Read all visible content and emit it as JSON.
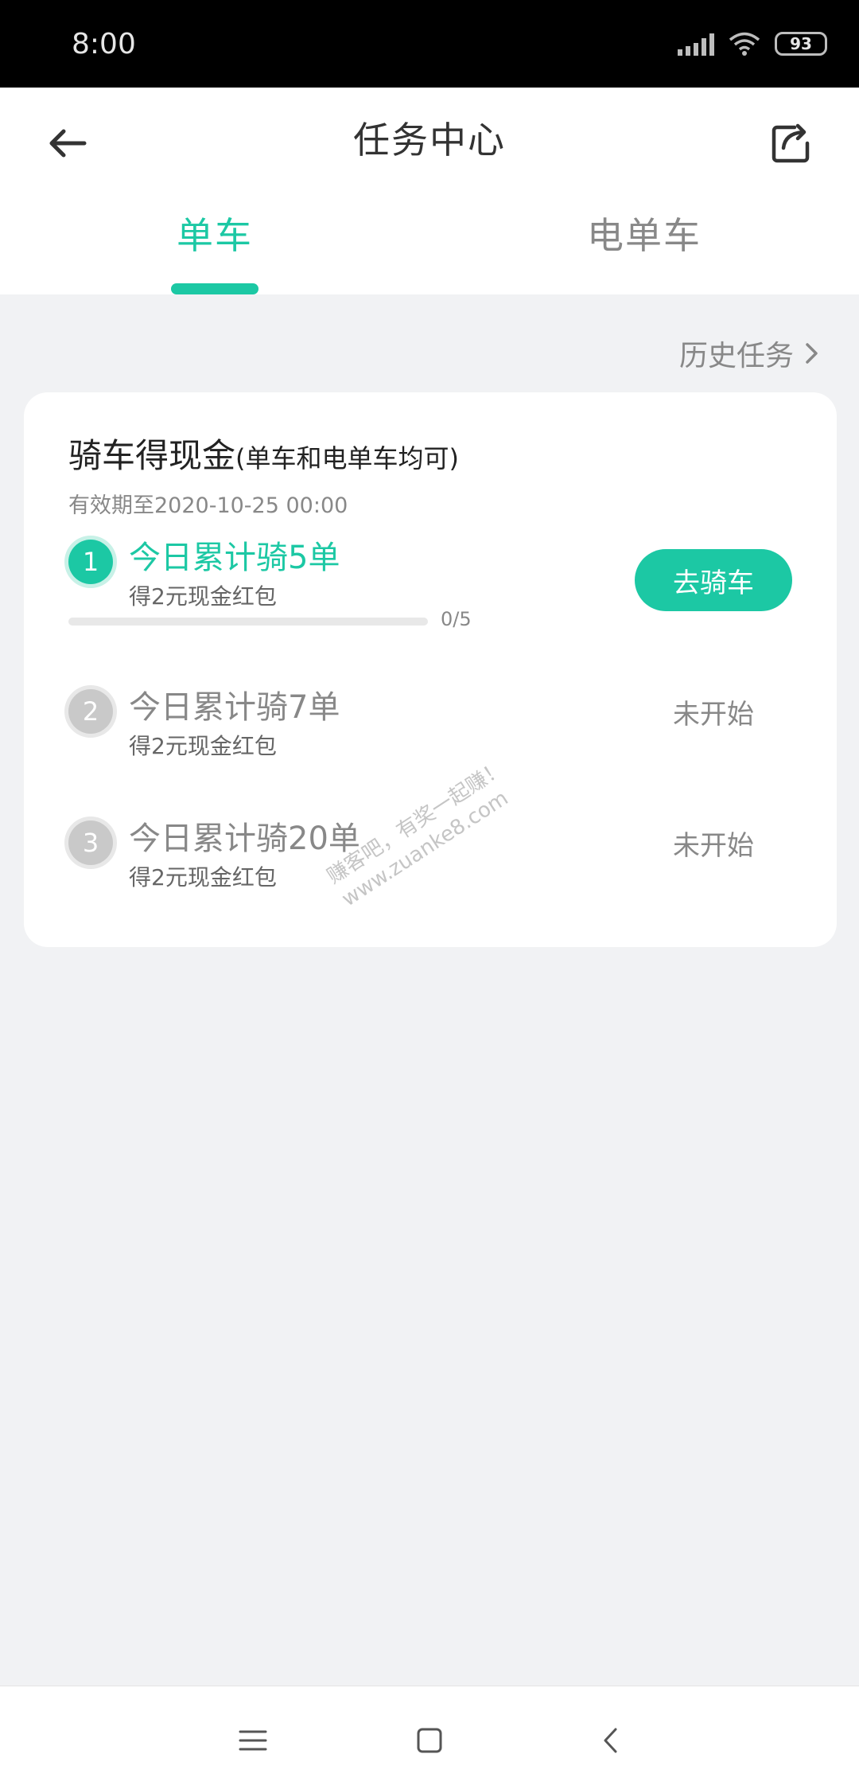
{
  "status_bar": {
    "time": "8:00",
    "battery": "93",
    "icons": [
      "signal-icon",
      "wifi-icon",
      "battery-icon"
    ]
  },
  "header": {
    "title": "任务中心",
    "back_icon": "arrow-left-icon",
    "share_icon": "share-icon"
  },
  "tabs": [
    {
      "label": "单车",
      "active": true
    },
    {
      "label": "电单车",
      "active": false
    }
  ],
  "history_link": "历史任务",
  "card": {
    "title": "骑车得现金",
    "title_sub": "(单车和电单车均可)",
    "validity": "有效期至2020-10-25 00:00",
    "tasks": [
      {
        "number": "1",
        "name": "今日累计骑5单",
        "reward": "得2元现金红包",
        "progress_text": "0/5",
        "progress": 0,
        "action": "去骑车"
      },
      {
        "number": "2",
        "name": "今日累计骑7单",
        "reward": "得2元现金红包",
        "status": "未开始"
      },
      {
        "number": "3",
        "name": "今日累计骑20单",
        "reward": "得2元现金红包",
        "status": "未开始"
      }
    ]
  },
  "watermark": {
    "line1": "赚客吧，有奖一起赚！",
    "line2": "www.zuanke8.com"
  },
  "colors": {
    "accent": "#1cc8a4",
    "background": "#f1f2f4"
  }
}
